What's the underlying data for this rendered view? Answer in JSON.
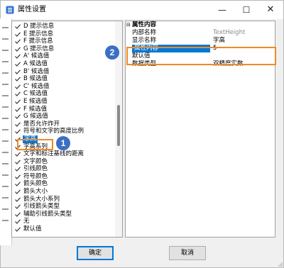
{
  "window": {
    "title": "属性设置",
    "minimize": "—",
    "maximize": "☐",
    "close": "✕"
  },
  "tree": {
    "items": [
      {
        "label": "D 提示信息"
      },
      {
        "label": "E 提示信息"
      },
      {
        "label": "F 提示信息"
      },
      {
        "label": "G 提示信息"
      },
      {
        "label": "A' 候选值"
      },
      {
        "label": "A 候选值"
      },
      {
        "label": "B' 候选值"
      },
      {
        "label": "B 候选值"
      },
      {
        "label": "C' 候选值"
      },
      {
        "label": "C 候选值"
      },
      {
        "label": "E 候选值"
      },
      {
        "label": "F 候选值"
      },
      {
        "label": "G 候选值"
      },
      {
        "label": "是否允许炸开"
      },
      {
        "label": "符号和文字的高度比例"
      },
      {
        "label": "字高",
        "selected": true
      },
      {
        "label": "字高系列"
      },
      {
        "label": "文字和标注基线的距离"
      },
      {
        "label": "文字颜色"
      },
      {
        "label": "引线颜色"
      },
      {
        "label": "符号颜色"
      },
      {
        "label": "箭头颜色"
      },
      {
        "label": "箭头大小"
      },
      {
        "label": "箭头大小系列"
      },
      {
        "label": "引线箭头类型"
      },
      {
        "label": "辅助引线箭头类型"
      },
      {
        "label": "无"
      },
      {
        "label": "默认值"
      }
    ]
  },
  "properties": {
    "category": "属性内容",
    "expander": "⊟",
    "rows": [
      {
        "key": "内部名称",
        "value": "TextHeight",
        "gray": true
      },
      {
        "key": "显示名称",
        "value": "字高"
      },
      {
        "key": "属性内容",
        "value": "5",
        "selected": true
      },
      {
        "key": "默认值",
        "value": ""
      },
      {
        "key": "数据类型",
        "value": "双精度实数"
      }
    ]
  },
  "buttons": {
    "ok": "确定",
    "cancel": "取消"
  },
  "annotations": {
    "badge1": "1",
    "badge2": "2"
  },
  "colors": {
    "selection": "#0078d7",
    "highlight": "#f08a24",
    "badge": "#3c6fc3"
  }
}
